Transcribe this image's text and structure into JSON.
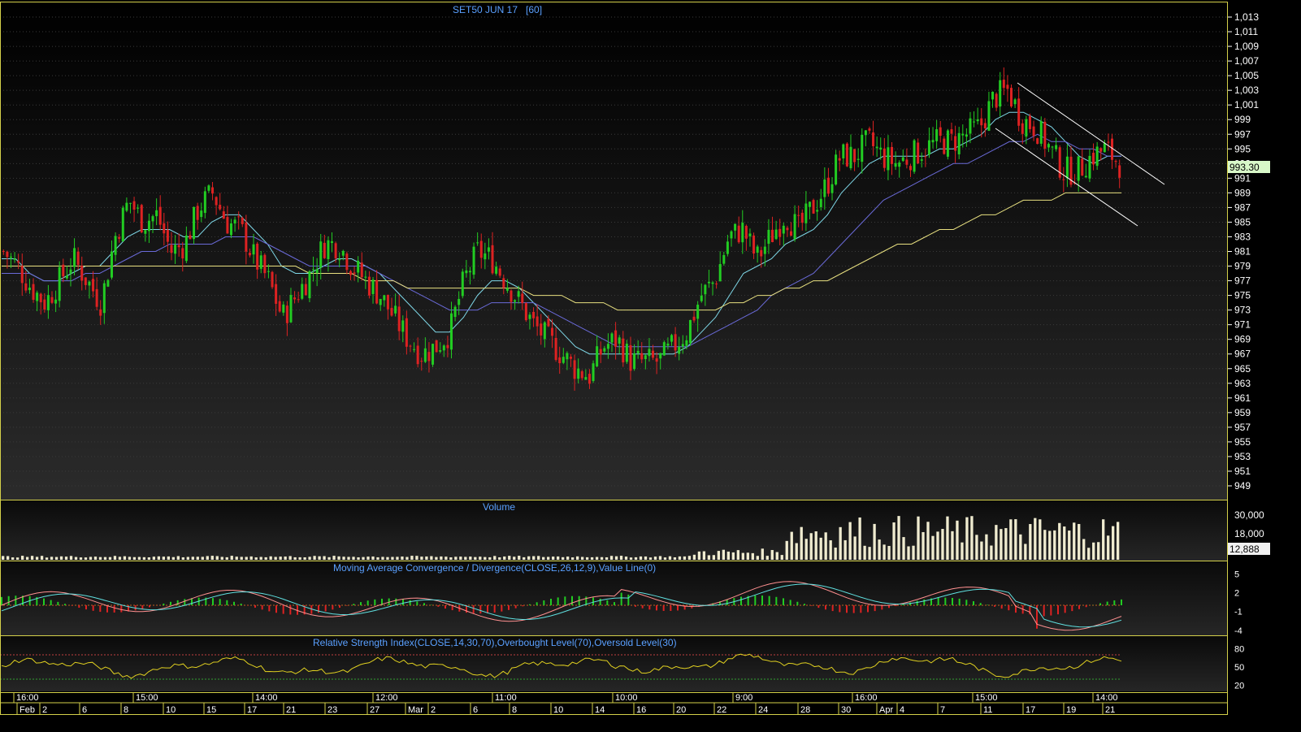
{
  "colors": {
    "background_top": "#000000",
    "background_bottom": "#2a2a2a",
    "border": "#d4d04a",
    "grid": "#3a3a3a",
    "up": "#22cc22",
    "down": "#dd2222",
    "ma_fast": "#7fd8e8",
    "ma_mid": "#6a6ad8",
    "ma_slow": "#e8e080",
    "trendline": "#ffffff",
    "volume": "#f0ecd0",
    "macd_line": "#ff9090",
    "signal_line": "#60e0e0",
    "rsi_line": "#e0d020",
    "price_tag": "#d8f8c8",
    "title_text": "#5aa0ff"
  },
  "chart_data": [
    {
      "type": "candlestick",
      "title": "SET50 JUN 17",
      "interval": "[60]",
      "ylim": [
        947,
        1014
      ],
      "y_ticks": [
        1013,
        1011,
        1009,
        1007,
        1005,
        1003,
        1001,
        999,
        997,
        995,
        993,
        991,
        989,
        987,
        985,
        983,
        981,
        979,
        977,
        975,
        973,
        971,
        969,
        967,
        965,
        963,
        961,
        959,
        957,
        955,
        953,
        951,
        949
      ],
      "last_price": "993.30",
      "approx_close_path": [
        981,
        979,
        976,
        974,
        977,
        980,
        977,
        974,
        983,
        988,
        985,
        986,
        981,
        982,
        987,
        989,
        985,
        984,
        980,
        977,
        972,
        975,
        978,
        982,
        982,
        979,
        977,
        975,
        972,
        969,
        967,
        968,
        970,
        977,
        981,
        980,
        977,
        974,
        971,
        969,
        967,
        965,
        964,
        968,
        969,
        966,
        966,
        966,
        968,
        970,
        975,
        977,
        983,
        984,
        980,
        983,
        986,
        984,
        987,
        990,
        994,
        994,
        996,
        994,
        993,
        994,
        995,
        996,
        996,
        997,
        998,
        1002,
        1003,
        999,
        998,
        995,
        992,
        992,
        994,
        995,
        993
      ],
      "series": [
        {
          "name": "MA fast",
          "values": [
            980,
            980,
            978,
            977,
            977,
            978,
            979,
            979,
            981,
            983,
            984,
            984,
            984,
            983,
            983,
            985,
            986,
            986,
            984,
            982,
            979,
            978,
            978,
            979,
            980,
            980,
            979,
            978,
            976,
            974,
            972,
            970,
            970,
            972,
            975,
            977,
            977,
            976,
            974,
            972,
            970,
            968,
            967,
            967,
            967,
            967,
            967,
            967,
            967,
            968,
            970,
            972,
            975,
            978,
            979,
            980,
            982,
            983,
            984,
            986,
            989,
            991,
            993,
            994,
            994,
            994,
            994,
            995,
            995,
            996,
            997,
            999,
            1000,
            1000,
            999,
            998,
            996,
            994,
            993,
            994,
            994
          ]
        },
        {
          "name": "MA mid",
          "values": [
            978,
            978,
            978,
            977,
            977,
            977,
            978,
            978,
            979,
            980,
            981,
            981,
            982,
            982,
            982,
            982,
            983,
            983,
            983,
            982,
            981,
            980,
            979,
            979,
            979,
            979,
            979,
            978,
            977,
            976,
            975,
            974,
            973,
            973,
            973,
            974,
            974,
            974,
            974,
            973,
            972,
            971,
            970,
            969,
            968,
            968,
            968,
            968,
            968,
            968,
            969,
            970,
            971,
            972,
            973,
            975,
            976,
            977,
            978,
            980,
            982,
            984,
            986,
            988,
            989,
            990,
            991,
            992,
            993,
            993,
            994,
            995,
            996,
            996,
            997,
            996,
            996,
            995,
            995,
            994,
            994
          ]
        },
        {
          "name": "MA slow",
          "values": [
            979,
            979,
            979,
            979,
            979,
            979,
            979,
            979,
            979,
            979,
            979,
            979,
            979,
            979,
            979,
            979,
            979,
            979,
            979,
            979,
            979,
            979,
            978,
            978,
            978,
            978,
            977,
            977,
            977,
            976,
            976,
            976,
            976,
            976,
            976,
            976,
            976,
            976,
            975,
            975,
            975,
            974,
            974,
            974,
            973,
            973,
            973,
            973,
            973,
            973,
            973,
            973,
            974,
            974,
            975,
            975,
            976,
            976,
            977,
            977,
            978,
            979,
            980,
            981,
            982,
            982,
            983,
            984,
            984,
            985,
            986,
            986,
            987,
            988,
            988,
            988,
            989,
            989,
            989,
            989,
            989
          ]
        }
      ]
    },
    {
      "type": "bar",
      "title": "Volume",
      "y_ticks": [
        30000,
        18000
      ],
      "y_tick_labels": [
        "30,000",
        "18,000"
      ],
      "last_value": "12,888"
    },
    {
      "type": "line",
      "title": "Moving Average Convergence / Divergence(CLOSE,26,12,9),Value Line(0)",
      "y_ticks": [
        5,
        2,
        -1,
        -4
      ]
    },
    {
      "type": "line",
      "title": "Relative Strength Index(CLOSE,14,30,70),Overbought Level(70),Oversold Level(30)",
      "y_ticks": [
        80,
        50,
        20
      ],
      "levels": [
        70,
        30
      ]
    }
  ],
  "x_axis": {
    "time_labels": [
      "16:00",
      "15:00",
      "14:00",
      "12:00",
      "11:00",
      "10:00",
      "9:00",
      "16:00",
      "15:00",
      "14:00"
    ],
    "date_labels": [
      "Feb",
      "2",
      "6",
      "8",
      "10",
      "15",
      "17",
      "21",
      "23",
      "27",
      "Mar",
      "2",
      "6",
      "8",
      "10",
      "14",
      "16",
      "20",
      "22",
      "24",
      "28",
      "30",
      "Apr",
      "4",
      "7",
      "11",
      "17",
      "19",
      "21"
    ]
  }
}
